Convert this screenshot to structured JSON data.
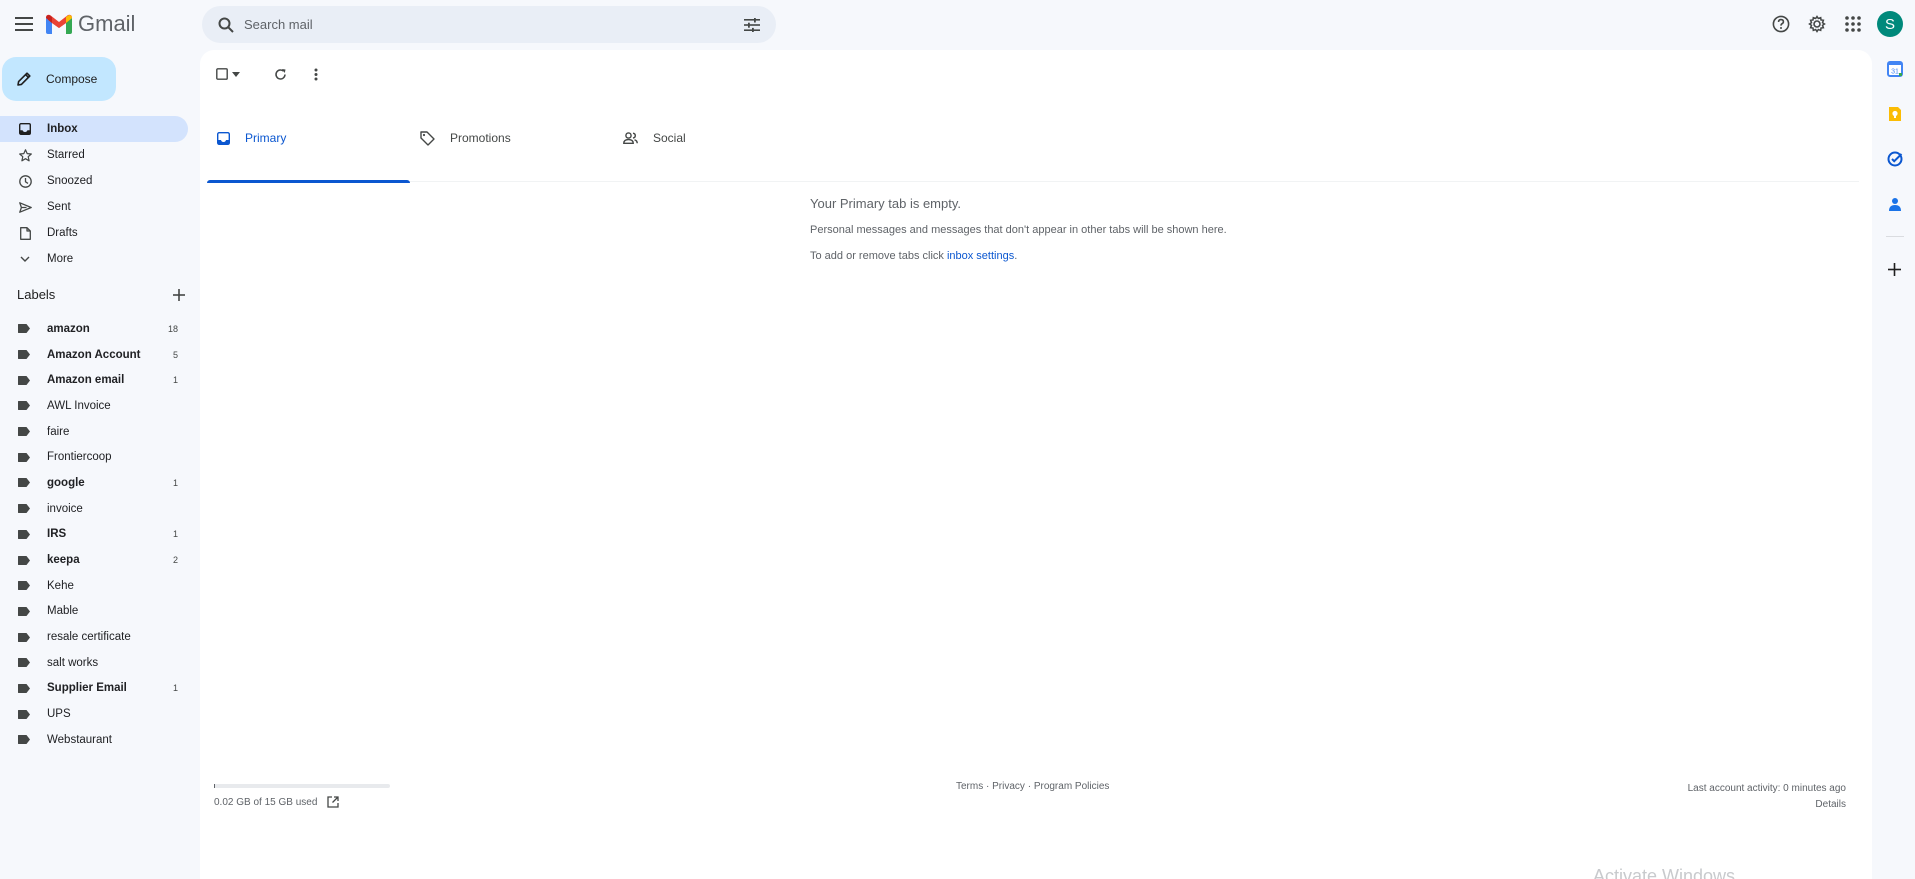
{
  "header": {
    "logo_text": "Gmail",
    "search_placeholder": "Search mail",
    "avatar_initial": "S"
  },
  "compose": {
    "label": "Compose"
  },
  "nav": {
    "items": [
      {
        "label": "Inbox",
        "icon": "inbox-icon",
        "active": true
      },
      {
        "label": "Starred",
        "icon": "star-icon"
      },
      {
        "label": "Snoozed",
        "icon": "clock-icon"
      },
      {
        "label": "Sent",
        "icon": "send-icon"
      },
      {
        "label": "Drafts",
        "icon": "draft-icon"
      },
      {
        "label": "More",
        "icon": "chevron-down-icon"
      }
    ]
  },
  "labels": {
    "title": "Labels",
    "items": [
      {
        "label": "amazon",
        "count": "18",
        "bold": true
      },
      {
        "label": "Amazon Account",
        "count": "5",
        "bold": true
      },
      {
        "label": "Amazon email",
        "count": "1",
        "bold": true
      },
      {
        "label": "AWL Invoice",
        "count": "",
        "bold": false
      },
      {
        "label": "faire",
        "count": "",
        "bold": false
      },
      {
        "label": "Frontiercoop",
        "count": "",
        "bold": false
      },
      {
        "label": "google",
        "count": "1",
        "bold": true
      },
      {
        "label": "invoice",
        "count": "",
        "bold": false
      },
      {
        "label": "IRS",
        "count": "1",
        "bold": true
      },
      {
        "label": "keepa",
        "count": "2",
        "bold": true
      },
      {
        "label": "Kehe",
        "count": "",
        "bold": false
      },
      {
        "label": "Mable",
        "count": "",
        "bold": false
      },
      {
        "label": "resale certificate",
        "count": "",
        "bold": false
      },
      {
        "label": "salt works",
        "count": "",
        "bold": false
      },
      {
        "label": "Supplier Email",
        "count": "1",
        "bold": true
      },
      {
        "label": "UPS",
        "count": "",
        "bold": false
      },
      {
        "label": "Webstaurant",
        "count": "",
        "bold": false
      }
    ]
  },
  "tabs": [
    {
      "label": "Primary",
      "active": true
    },
    {
      "label": "Promotions",
      "active": false
    },
    {
      "label": "Social",
      "active": false
    }
  ],
  "empty": {
    "heading": "Your Primary tab is empty.",
    "line1": "Personal messages and messages that don't appear in other tabs will be shown here.",
    "line2_prefix": "To add or remove tabs click ",
    "line2_link": "inbox settings",
    "line2_suffix": "."
  },
  "footer": {
    "storage": "0.02 GB of 15 GB used",
    "storage_fraction": 0.0013,
    "terms": "Terms",
    "privacy": "Privacy",
    "policies": "Program Policies",
    "sep": " · ",
    "last_activity": "Last account activity: 0 minutes ago",
    "details": "Details"
  },
  "watermark": "Activate Windows",
  "colors": {
    "accent": "#0b57d0",
    "compose_bg": "#c2e7ff",
    "active_nav": "#d3e3fd",
    "avatar": "#00897b"
  }
}
